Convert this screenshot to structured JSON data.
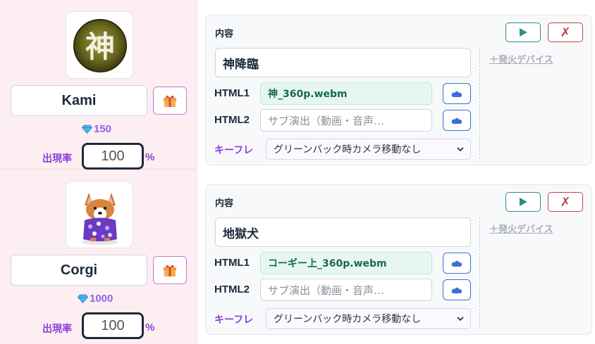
{
  "gifts": [
    {
      "name": "Kami",
      "price": "150",
      "rate_label": "出現率",
      "rate": "100",
      "pct": "%",
      "thumb_char": "神"
    },
    {
      "name": "Corgi",
      "price": "1000",
      "rate_label": "出現率",
      "rate": "100",
      "pct": "%"
    }
  ],
  "cards": [
    {
      "title": "内容",
      "content": "神降臨",
      "html1_label": "HTML1",
      "html1_value": "神_360p.webm",
      "html2_label": "HTML2",
      "html2_placeholder": "サブ演出（動画・音声…",
      "keyframe_label": "キーフレ",
      "keyframe_value": "グリーンバック時カメラ移動なし",
      "add_device": "＋発火デバイス",
      "delete_glyph": "✗"
    },
    {
      "title": "内容",
      "content": "地獄犬",
      "html1_label": "HTML1",
      "html1_value": "コーギー上_360p.webm",
      "html2_label": "HTML2",
      "html2_placeholder": "サブ演出（動画・音声…",
      "keyframe_label": "キーフレ",
      "keyframe_value": "グリーンバック時カメラ移動なし",
      "add_device": "＋発火デバイス",
      "delete_glyph": "✗"
    }
  ],
  "colors": {
    "left_bg": "#fdeef1",
    "accent_purple": "#8a3fd6",
    "play_teal": "#2b8f86",
    "delete_red": "#c04545",
    "download_blue": "#3b6fd8"
  },
  "icons": {
    "gift": "gift-icon",
    "diamond": "diamond-icon",
    "play": "play-icon",
    "download": "download-icon",
    "chevron": "chevron-down-icon"
  }
}
